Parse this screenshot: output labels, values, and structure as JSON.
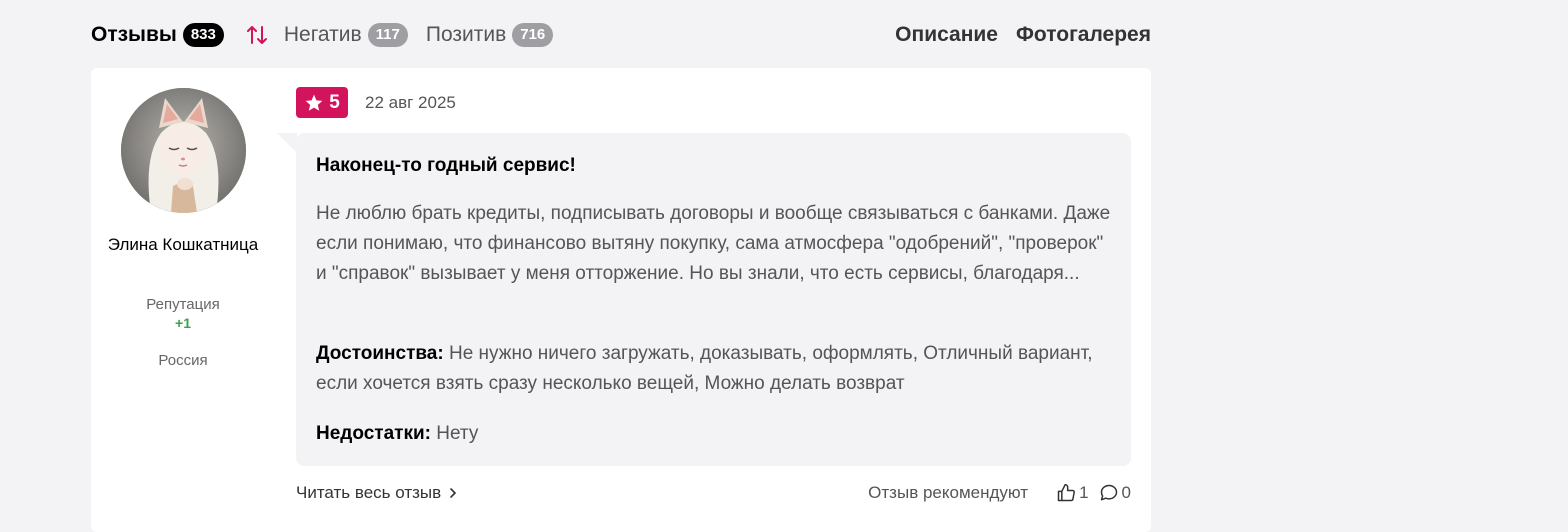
{
  "tabs": {
    "reviews": {
      "label": "Отзывы",
      "count": "833"
    },
    "negative": {
      "label": "Негатив",
      "count": "117"
    },
    "positive": {
      "label": "Позитив",
      "count": "716"
    },
    "description": "Описание",
    "gallery": "Фотогалерея"
  },
  "review": {
    "author": {
      "name": "Элина Кошкатница",
      "reputation_label": "Репутация",
      "reputation_value": "+1",
      "country": "Россия",
      "avatar_icon": "cat-girl-avatar"
    },
    "rating": "5",
    "date": "22 авг 2025",
    "title": "Наконец-то годный сервис!",
    "text": "Не люблю брать кредиты, подписывать договоры и вообще связываться с банками. Даже если понимаю, что финансово вытяну покупку, сама атмосфера \"одобрений\", \"проверок\" и \"справок\" вызывает у меня отторжение. Но вы знали, что есть сервисы, благодаря...",
    "pros_label": "Достоинства:",
    "pros": "Не нужно ничего загружать, доказывать, оформлять, Отличный вариант, если хочется взять сразу несколько вещей, Можно делать возврат",
    "cons_label": "Недостатки:",
    "cons": "Нету",
    "read_more": "Читать весь отзыв",
    "recommend": "Отзыв рекомендуют",
    "likes": "1",
    "comments": "0"
  },
  "colors": {
    "accent": "#d4135d",
    "reputation": "#3aa34a",
    "badge_gray": "#9e9ea3"
  }
}
